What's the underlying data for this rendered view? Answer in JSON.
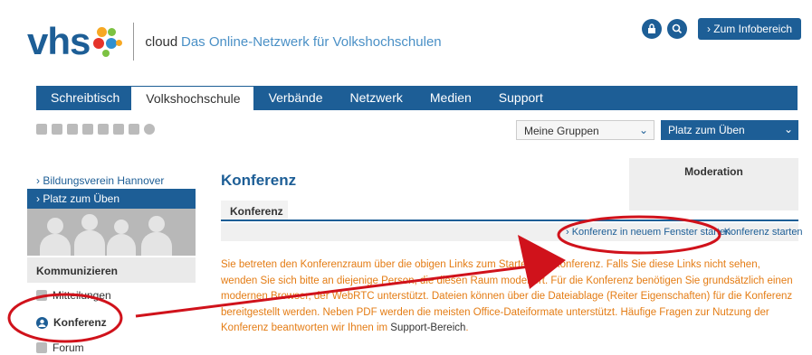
{
  "header": {
    "logo_text": "vhs",
    "logo_sub": "cloud",
    "tagline": "Das Online-Netzwerk für Volkshochschulen",
    "info_button": "› Zum Infobereich"
  },
  "icons": [
    "lock-icon",
    "search-icon"
  ],
  "nav": {
    "items": [
      {
        "label": "Schreibtisch"
      },
      {
        "label": "Volkshochschule"
      },
      {
        "label": "Verbände"
      },
      {
        "label": "Netzwerk"
      },
      {
        "label": "Medien"
      },
      {
        "label": "Support"
      }
    ],
    "active_index": 1
  },
  "selects": {
    "groups": "Meine Gruppen",
    "place": "Platz zum Üben"
  },
  "sidebar": {
    "link_org": "› Bildungsverein Hannover",
    "link_active": "› Platz zum Üben",
    "section": "Kommunizieren",
    "items": [
      {
        "label": "Mitteilungen"
      },
      {
        "label": "Konferenz"
      },
      {
        "label": "Forum"
      }
    ]
  },
  "main": {
    "title": "Konferenz",
    "tab": "Konferenz",
    "moderation": "Moderation",
    "action_new_window": "› Konferenz in neuem Fenster starten",
    "action_start": "› Konferenz starten",
    "body_part1": "Sie betreten den Konferenzraum über die obigen Links zum Starten der Konferenz. Falls Sie diese Links nicht sehen, wenden Sie sich bitte an diejenige Person, die diesen Raum moderiert. Für die Konferenz benötigen Sie grundsätzlich einen modernen Browser, der WebRTC unterstützt. Dateien können über die Dateiablage (Reiter Eigenschaften) für die Konferenz bereitgestellt werden. Neben PDF werden die meisten Office-Dateiformate unterstützt. Häufige Fragen zur Nutzung der Konferenz beantworten wir Ihnen im ",
    "body_link": "Support-Bereich",
    "body_end": "."
  },
  "colors": {
    "brand": "#1d5e96",
    "accent_text": "#e47c14",
    "annotation": "#d0121b"
  }
}
